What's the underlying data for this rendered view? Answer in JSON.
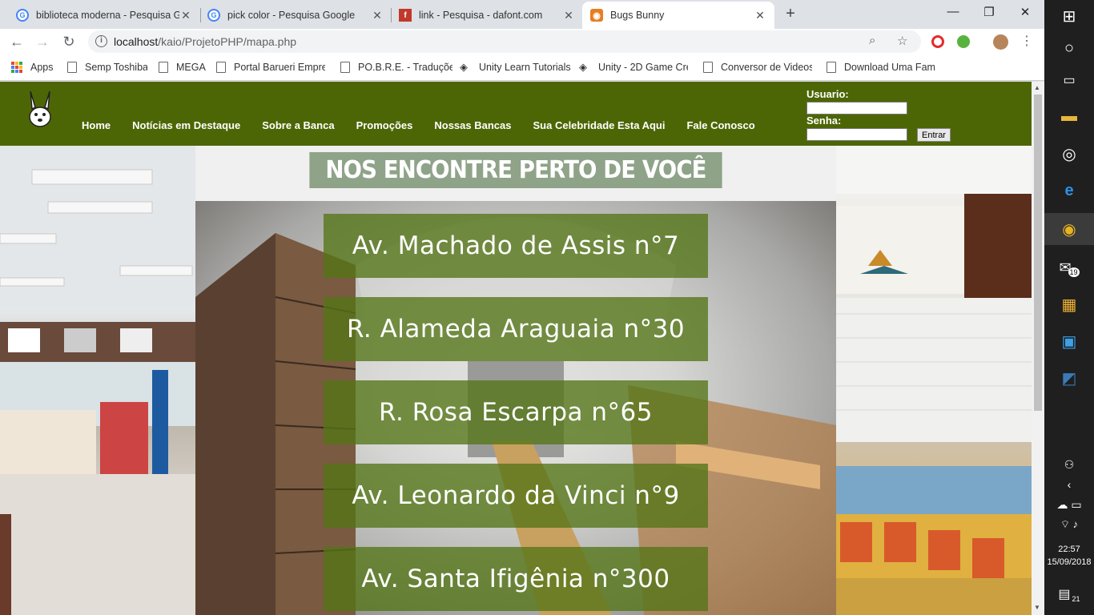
{
  "browser": {
    "tabs": [
      {
        "title": "biblioteca moderna - Pesquisa Go",
        "favicon": "google-icon"
      },
      {
        "title": "pick color - Pesquisa Google",
        "favicon": "google-icon"
      },
      {
        "title": "link - Pesquisa - dafont.com",
        "favicon": "dafont-icon"
      },
      {
        "title": "Bugs Bunny",
        "favicon": "site-icon",
        "active": true
      }
    ],
    "new_tab": "+",
    "window_controls": {
      "minimize": "—",
      "maximize": "❐",
      "close": "✕"
    },
    "url_host": "localhost",
    "url_path": "/kaio/ProjetoPHP/mapa.php",
    "bookmarks": [
      {
        "label": "Apps",
        "icon": "apps-grid-icon"
      },
      {
        "label": "Semp Toshiba",
        "icon": "page-icon"
      },
      {
        "label": "MEGA",
        "icon": "page-icon"
      },
      {
        "label": "Portal Barueri Empre",
        "icon": "page-icon"
      },
      {
        "label": "PO.B.R.E. - Traduções",
        "icon": "page-icon"
      },
      {
        "label": "Unity Learn Tutorials",
        "icon": "unity-icon"
      },
      {
        "label": "Unity - 2D Game Cre",
        "icon": "unity-icon"
      },
      {
        "label": "Conversor de Videos c",
        "icon": "page-icon"
      },
      {
        "label": "Download Uma Famí",
        "icon": "page-icon"
      }
    ]
  },
  "site": {
    "header_color": "#4d6605",
    "nav": [
      "Home",
      "Notícias em Destaque",
      "Sobre a Banca",
      "Promoções",
      "Nossas Bancas",
      "Sua Celebridade Esta Aqui",
      "Fale Conosco"
    ],
    "login": {
      "user_label": "Usuario:",
      "pass_label": "Senha:",
      "submit": "Entrar"
    },
    "banner": "NOS ENCONTRE PERTO DE VOCÊ",
    "addresses": [
      "Av. Machado de Assis n°7",
      "R. Alameda Araguaia n°30",
      "R. Rosa Escarpa n°65",
      "Av. Leonardo da Vinci n°9",
      "Av. Santa Ifigênia n°300"
    ]
  },
  "taskbar": {
    "mail_badge": "19",
    "time": "22:57",
    "date": "15/09/2018",
    "notifications": "21"
  }
}
